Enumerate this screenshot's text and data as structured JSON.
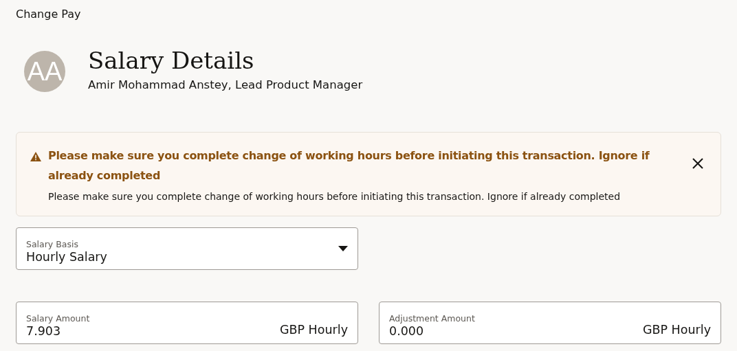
{
  "page_title": "Change Pay",
  "header": {
    "avatar_initials": "AA",
    "title": "Salary Details",
    "subtitle": "Amir Mohammad Anstey, Lead Product Manager"
  },
  "warning": {
    "title": "Please make sure you complete change of working hours before initiating this transaction. Ignore if already completed",
    "message": "Please make sure you complete change of working hours before initiating this transaction. Ignore if already completed"
  },
  "fields": [
    {
      "kind": "select",
      "label": "Salary Basis",
      "value": "Hourly Salary"
    },
    {
      "kind": "amount",
      "label": "Salary Amount",
      "value": "7.903",
      "unit": "GBP Hourly"
    },
    {
      "kind": "amount",
      "label": "Adjustment Amount",
      "value": "0.000",
      "unit": "GBP Hourly"
    }
  ]
}
